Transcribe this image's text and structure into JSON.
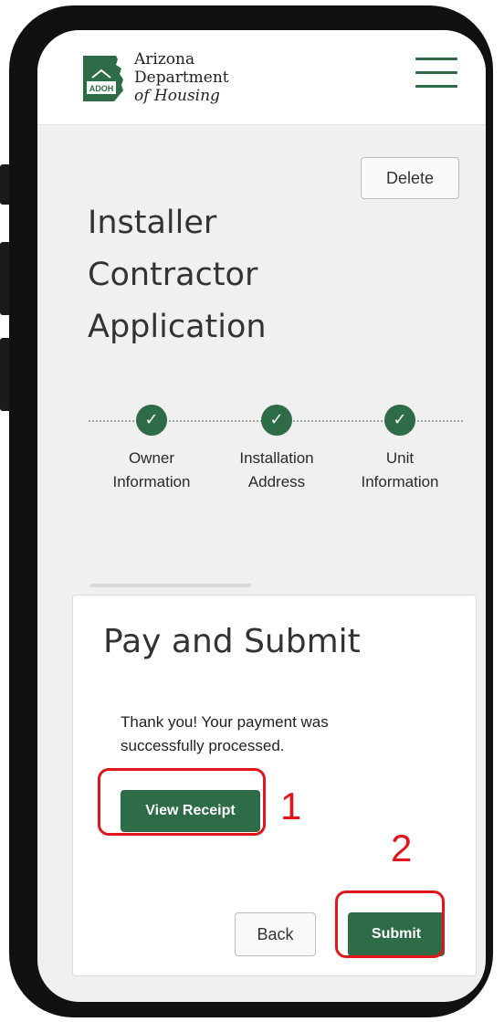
{
  "header": {
    "logo_badge": "ADOH",
    "logo_lines": [
      "Arizona",
      "Department",
      "of Housing"
    ],
    "menu_icon": "hamburger-menu-icon"
  },
  "delete_label": "Delete",
  "page_title_lines": [
    "Installer",
    "Contractor",
    "Application"
  ],
  "stepper": {
    "check_glyph": "✓",
    "steps": [
      {
        "line1": "Owner",
        "line2": "Information",
        "status": "complete"
      },
      {
        "line1": "Installation",
        "line2": "Address",
        "status": "complete"
      },
      {
        "line1": "Unit",
        "line2": "Information",
        "status": "complete"
      }
    ]
  },
  "card": {
    "title": "Pay and Submit",
    "message": "Thank you! Your payment was successfully processed.",
    "view_receipt_label": "View Receipt",
    "back_label": "Back",
    "submit_label": "Submit"
  },
  "annotations": [
    {
      "number": "1",
      "target": "View Receipt"
    },
    {
      "number": "2",
      "target": "Submit"
    }
  ],
  "colors": {
    "brand_green": "#2e6b47",
    "annotation_red": "#e0161b",
    "phone_frame": "#111111",
    "screen_bg": "#f0f0f0"
  }
}
